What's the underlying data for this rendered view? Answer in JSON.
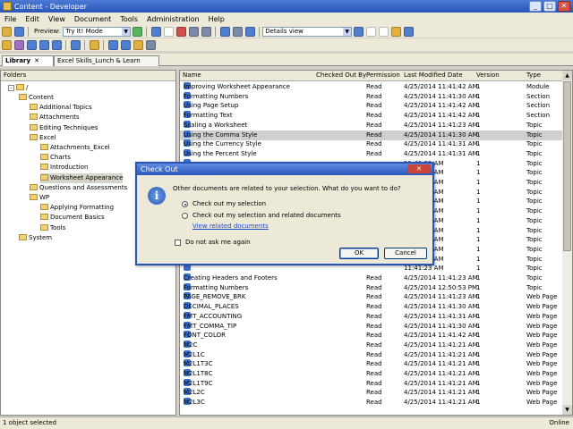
{
  "window": {
    "title": "Content - Developer"
  },
  "menu": [
    "File",
    "Edit",
    "View",
    "Document",
    "Tools",
    "Administration",
    "Help"
  ],
  "toolbar": {
    "preview_label": "Preview:",
    "preview_value": "Try It! Mode",
    "view_value": "Details view"
  },
  "tabs": [
    "Library",
    "Excel Skills_Lunch & Learn"
  ],
  "tree": {
    "header": "Folders",
    "root": "/",
    "items": [
      {
        "label": "Content",
        "depth": 1
      },
      {
        "label": "Additional Topics",
        "depth": 2
      },
      {
        "label": "Attachments",
        "depth": 2
      },
      {
        "label": "Editing Techniques",
        "depth": 2
      },
      {
        "label": "Excel",
        "depth": 2
      },
      {
        "label": "Attachments_Excel",
        "depth": 3
      },
      {
        "label": "Charts",
        "depth": 3
      },
      {
        "label": "Introduction",
        "depth": 3
      },
      {
        "label": "Worksheet Appearance",
        "depth": 3,
        "selected": true
      },
      {
        "label": "Questions and Assessments",
        "depth": 2
      },
      {
        "label": "WP",
        "depth": 2
      },
      {
        "label": "Applying Formatting",
        "depth": 3
      },
      {
        "label": "Document Basics",
        "depth": 3
      },
      {
        "label": "Tools",
        "depth": 3
      },
      {
        "label": "System",
        "depth": 1
      }
    ]
  },
  "columns": [
    "Name",
    "Checked Out By",
    "Permission",
    "Last Modified Date",
    "Version",
    "Type"
  ],
  "rows": [
    {
      "name": "Improving Worksheet Appearance",
      "perm": "Read",
      "date": "4/25/2014 11:41:42 AM",
      "ver": "1",
      "type": "Module"
    },
    {
      "name": "Formatting Numbers",
      "perm": "Read",
      "date": "4/25/2014 11:41:30 AM",
      "ver": "1",
      "type": "Section"
    },
    {
      "name": "Using Page Setup",
      "perm": "Read",
      "date": "4/25/2014 11:41:42 AM",
      "ver": "1",
      "type": "Section"
    },
    {
      "name": "Formatting Text",
      "perm": "Read",
      "date": "4/25/2014 11:41:42 AM",
      "ver": "1",
      "type": "Section"
    },
    {
      "name": "Scaling a Worksheet",
      "perm": "Read",
      "date": "4/25/2014 11:41:23 AM",
      "ver": "1",
      "type": "Topic"
    },
    {
      "name": "Using the Comma Style",
      "perm": "Read",
      "date": "4/25/2014 11:41:30 AM",
      "ver": "1",
      "type": "Topic",
      "selected": true
    },
    {
      "name": "Using the Currency Style",
      "perm": "Read",
      "date": "4/25/2014 11:41:31 AM",
      "ver": "1",
      "type": "Topic"
    },
    {
      "name": "Using the Percent Style",
      "perm": "Read",
      "date": "4/25/2014 11:41:31 AM",
      "ver": "1",
      "type": "Topic"
    },
    {
      "name": "",
      "perm": "",
      "date": "11:41:31 AM",
      "ver": "1",
      "type": "Topic"
    },
    {
      "name": "",
      "perm": "",
      "date": "11:41:31 AM",
      "ver": "1",
      "type": "Topic"
    },
    {
      "name": "",
      "perm": "",
      "date": "11:41:32 AM",
      "ver": "1",
      "type": "Topic"
    },
    {
      "name": "",
      "perm": "",
      "date": "11:41:32 AM",
      "ver": "1",
      "type": "Topic"
    },
    {
      "name": "",
      "perm": "",
      "date": "11:41:32 AM",
      "ver": "1",
      "type": "Topic"
    },
    {
      "name": "",
      "perm": "",
      "date": "11:41:33 AM",
      "ver": "1",
      "type": "Topic"
    },
    {
      "name": "",
      "perm": "",
      "date": "11:41:33 AM",
      "ver": "1",
      "type": "Topic"
    },
    {
      "name": "",
      "perm": "",
      "date": "11:41:33 AM",
      "ver": "1",
      "type": "Topic"
    },
    {
      "name": "",
      "perm": "",
      "date": "11:41:40 AM",
      "ver": "1",
      "type": "Topic"
    },
    {
      "name": "",
      "perm": "",
      "date": "11:41:41 AM",
      "ver": "1",
      "type": "Topic"
    },
    {
      "name": "",
      "perm": "",
      "date": "11:41:23 AM",
      "ver": "1",
      "type": "Topic"
    },
    {
      "name": "",
      "perm": "",
      "date": "11:41:23 AM",
      "ver": "1",
      "type": "Topic"
    },
    {
      "name": "Creating Headers and Footers",
      "perm": "Read",
      "date": "4/25/2014 11:41:23 AM",
      "ver": "1",
      "type": "Topic"
    },
    {
      "name": "Formatting Numbers",
      "perm": "Read",
      "date": "4/25/2014 12:50:53 PM",
      "ver": "1",
      "type": "Topic"
    },
    {
      "name": "PAGE_REMOVE_BRK",
      "perm": "Read",
      "date": "4/25/2014 11:41:23 AM",
      "ver": "1",
      "type": "Web Page"
    },
    {
      "name": "DECIMAL_PLACES",
      "perm": "Read",
      "date": "4/25/2014 11:41:30 AM",
      "ver": "1",
      "type": "Web Page"
    },
    {
      "name": "FMT_ACCOUNTING",
      "perm": "Read",
      "date": "4/25/2014 11:41:31 AM",
      "ver": "1",
      "type": "Web Page"
    },
    {
      "name": "FMT_COMMA_TIP",
      "perm": "Read",
      "date": "4/25/2014 11:41:30 AM",
      "ver": "1",
      "type": "Web Page"
    },
    {
      "name": "FONT_COLOR",
      "perm": "Read",
      "date": "4/25/2014 11:41:42 AM",
      "ver": "1",
      "type": "Web Page"
    },
    {
      "name": "M2C",
      "perm": "Read",
      "date": "4/25/2014 11:41:21 AM",
      "ver": "1",
      "type": "Web Page"
    },
    {
      "name": "M2L1C",
      "perm": "Read",
      "date": "4/25/2014 11:41:21 AM",
      "ver": "1",
      "type": "Web Page"
    },
    {
      "name": "M2L1T3C",
      "perm": "Read",
      "date": "4/25/2014 11:41:21 AM",
      "ver": "1",
      "type": "Web Page"
    },
    {
      "name": "M2L1T8C",
      "perm": "Read",
      "date": "4/25/2014 11:41:21 AM",
      "ver": "1",
      "type": "Web Page"
    },
    {
      "name": "M2L1T9C",
      "perm": "Read",
      "date": "4/25/2014 11:41:21 AM",
      "ver": "1",
      "type": "Web Page"
    },
    {
      "name": "M2L2C",
      "perm": "Read",
      "date": "4/25/2014 11:41:21 AM",
      "ver": "1",
      "type": "Web Page"
    },
    {
      "name": "M2L3C",
      "perm": "Read",
      "date": "4/25/2014 11:41:21 AM",
      "ver": "1",
      "type": "Web Page"
    }
  ],
  "status": {
    "left": "1 object selected",
    "right": "Online"
  },
  "dialog": {
    "title": "Check Out",
    "close": "✕",
    "message": "Other documents are related to your selection. What do you want to do?",
    "option1": "Check out my selection",
    "option2": "Check out my selection and related documents",
    "link": "View related documents",
    "checkbox": "Do not ask me again",
    "ok": "OK",
    "cancel": "Cancel"
  }
}
